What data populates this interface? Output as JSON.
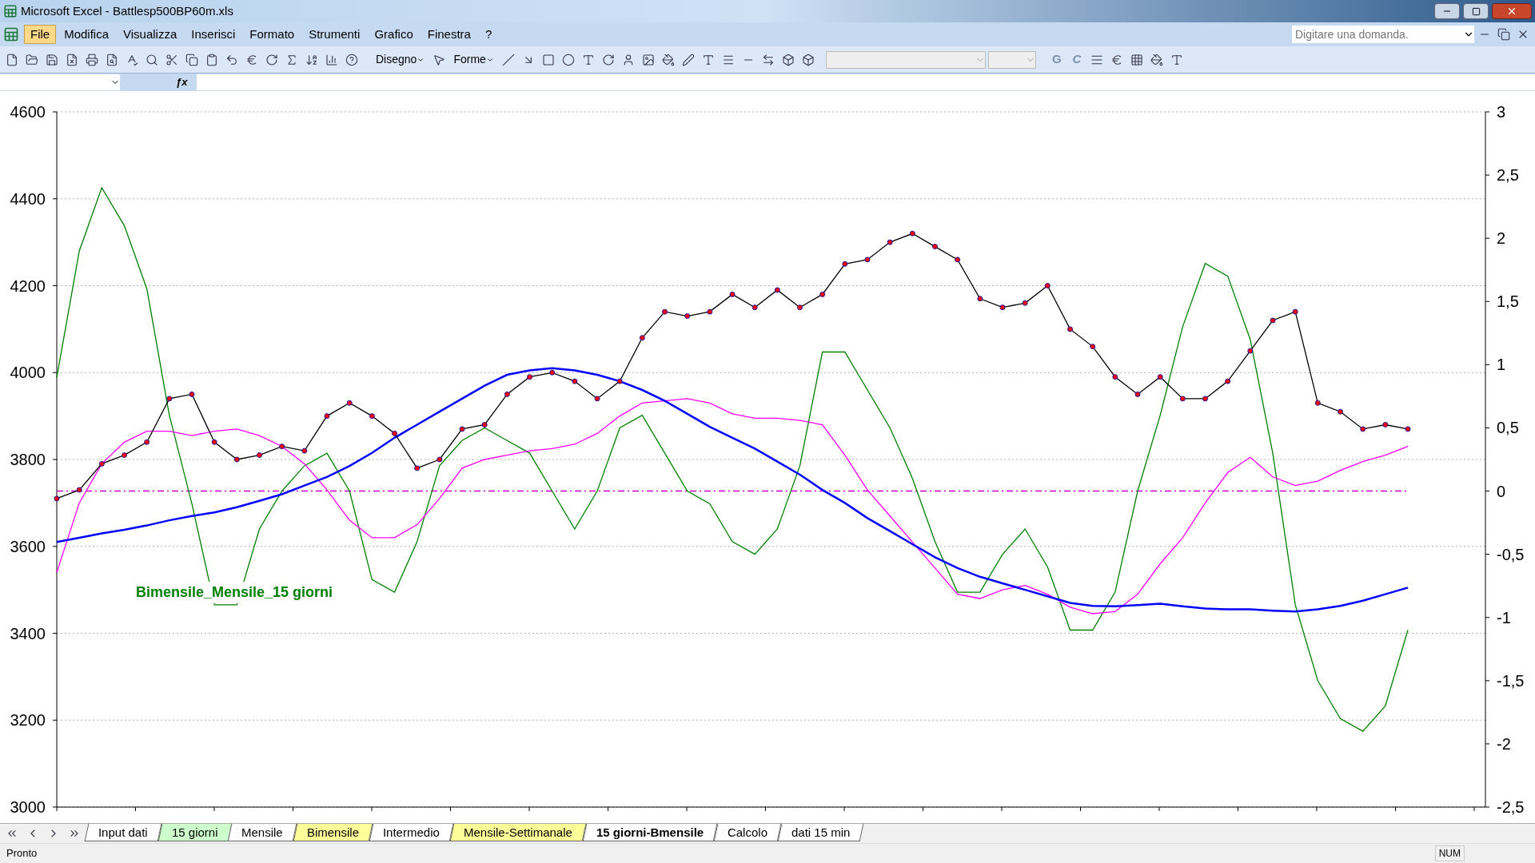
{
  "window": {
    "title": "Microsoft Excel - Battlesp500BP60m.xls"
  },
  "menu": [
    {
      "label": "File",
      "selected": true
    },
    {
      "label": "Modifica",
      "selected": false
    },
    {
      "label": "Visualizza",
      "selected": false
    },
    {
      "label": "Inserisci",
      "selected": false
    },
    {
      "label": "Formato",
      "selected": false
    },
    {
      "label": "Strumenti",
      "selected": false
    },
    {
      "label": "Grafico",
      "selected": false
    },
    {
      "label": "Finestra",
      "selected": false
    },
    {
      "label": "?",
      "selected": false
    }
  ],
  "help": {
    "placeholder": "Digitare una domanda."
  },
  "drawing_toolbar": {
    "draw": "Disegno",
    "shapes": "Forme"
  },
  "format_toolbar": {
    "bold": "G",
    "italic": "C"
  },
  "formula_bar": {
    "function_symbol": "ƒx"
  },
  "chart": {
    "text_label": "Bimensile_Mensile_15 giorni",
    "chart_data": {
      "type": "line",
      "grid": true,
      "ylim": [
        3000,
        4600
      ],
      "yticks": [
        3000,
        3200,
        3400,
        3600,
        3800,
        4000,
        4200,
        4400,
        4600
      ],
      "y2lim": [
        -2.5,
        3
      ],
      "y2ticks": [
        {
          "value": -2.5,
          "label": "-2,5"
        },
        {
          "value": -2,
          "label": "-2"
        },
        {
          "value": -1.5,
          "label": "-1,5"
        },
        {
          "value": -1,
          "label": "-1"
        },
        {
          "value": -0.5,
          "label": "-0,5"
        },
        {
          "value": 0,
          "label": "0"
        },
        {
          "value": 0.5,
          "label": "0,5"
        },
        {
          "value": 1,
          "label": "1"
        },
        {
          "value": 1.5,
          "label": "1,5"
        },
        {
          "value": 2,
          "label": "2"
        },
        {
          "value": 2.5,
          "label": "2,5"
        },
        {
          "value": 3,
          "label": "3"
        }
      ],
      "ref_lines": [
        {
          "axis": "y2",
          "value": 0,
          "color": "#cc00cc"
        }
      ],
      "series": [
        {
          "color": "#008000",
          "axis": "y2",
          "values": [
            0.9,
            1.9,
            2.4,
            2.1,
            1.6,
            0.6,
            -0.1,
            -0.9,
            -0.9,
            -0.3,
            0,
            0.2,
            0.3,
            0,
            -0.7,
            -0.8,
            -0.4,
            0.2,
            0.4,
            0.5,
            0.4,
            0.3,
            0,
            -0.3,
            0,
            0.5,
            0.6,
            0.3,
            0,
            -0.1,
            -0.4,
            -0.5,
            -0.3,
            0.2,
            1.1,
            1.1,
            0.8,
            0.5,
            0.1,
            -0.4,
            -0.8,
            -0.8,
            -0.5,
            -0.3,
            -0.6,
            -1.1,
            -1.1,
            -0.8,
            0,
            0.6,
            1.3,
            1.8,
            1.7,
            1.2,
            0.3,
            -0.9,
            -1.5,
            -1.8,
            -1.9,
            -1.7,
            -1.1
          ]
        },
        {
          "color": "#ff00ff",
          "values": [
            3540,
            3700,
            3790,
            3840,
            3865,
            3865,
            3855,
            3865,
            3870,
            3855,
            3830,
            3790,
            3730,
            3660,
            3620,
            3620,
            3650,
            3710,
            3780,
            3800,
            3810,
            3820,
            3825,
            3835,
            3860,
            3900,
            3930,
            3935,
            3940,
            3930,
            3905,
            3895,
            3895,
            3890,
            3880,
            3810,
            3730,
            3670,
            3610,
            3550,
            3490,
            3480,
            3500,
            3510,
            3490,
            3460,
            3445,
            3450,
            3490,
            3560,
            3620,
            3700,
            3770,
            3805,
            3760,
            3740,
            3750,
            3775,
            3795,
            3810,
            3830
          ]
        },
        {
          "color": "#0000ff",
          "values": [
            3610,
            3620,
            3630,
            3638,
            3648,
            3660,
            3670,
            3678,
            3690,
            3705,
            3720,
            3740,
            3760,
            3785,
            3815,
            3850,
            3880,
            3910,
            3940,
            3970,
            3995,
            4005,
            4010,
            4005,
            3995,
            3980,
            3960,
            3935,
            3905,
            3875,
            3850,
            3825,
            3795,
            3765,
            3730,
            3700,
            3665,
            3635,
            3605,
            3575,
            3550,
            3530,
            3515,
            3500,
            3485,
            3470,
            3463,
            3462,
            3465,
            3468,
            3462,
            3457,
            3455,
            3455,
            3452,
            3450,
            3455,
            3463,
            3475,
            3490,
            3505
          ]
        },
        {
          "color": "#ff0000",
          "marker": "circle",
          "values": [
            3710,
            3730,
            3790,
            3810,
            3840,
            3940,
            3950,
            3840,
            3800,
            3810,
            3830,
            3820,
            3900,
            3930,
            3900,
            3860,
            3780,
            3800,
            3870,
            3880,
            3950,
            3990,
            4000,
            3980,
            3940,
            3980,
            4080,
            4140,
            4130,
            4140,
            4180,
            4150,
            4190,
            4150,
            4180,
            4250,
            4260,
            4300,
            4320,
            4290,
            4260,
            4170,
            4150,
            4160,
            4200,
            4100,
            4060,
            3990,
            3950,
            3990,
            3940,
            3940,
            3980,
            4050,
            4120,
            4140,
            3930,
            3910,
            3870,
            3880,
            3870
          ]
        }
      ]
    }
  },
  "sheet_tabs": [
    {
      "label": "Input dati",
      "selected": false,
      "color": "#ffffff"
    },
    {
      "label": "15 giorni",
      "selected": false,
      "color": "#ccffcc"
    },
    {
      "label": "Mensile",
      "selected": false,
      "color": "#ffffff"
    },
    {
      "label": "Bimensile",
      "selected": false,
      "color": "#ffff99"
    },
    {
      "label": "Intermedio",
      "selected": false,
      "color": "#ffffff"
    },
    {
      "label": "Mensile-Settimanale",
      "selected": false,
      "color": "#ffff99"
    },
    {
      "label": "15 giorni-Bmensile",
      "selected": true,
      "color": "#ffffff"
    },
    {
      "label": "Calcolo",
      "selected": false,
      "color": "#ffffff"
    },
    {
      "label": "dati 15 min",
      "selected": false,
      "color": "#ffffff"
    }
  ],
  "status_bar": {
    "status": "Pronto",
    "num": "NUM"
  }
}
